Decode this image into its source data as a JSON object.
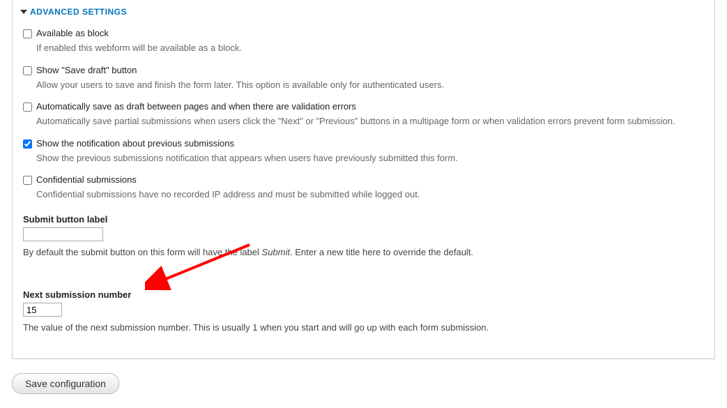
{
  "fieldset": {
    "legend": "ADVANCED SETTINGS"
  },
  "options": {
    "available_as_block": {
      "label": "Available as block",
      "checked": false,
      "description": "If enabled this webform will be available as a block."
    },
    "show_save_draft": {
      "label": "Show \"Save draft\" button",
      "checked": false,
      "description": "Allow your users to save and finish the form later. This option is available only for authenticated users."
    },
    "auto_save_draft": {
      "label": "Automatically save as draft between pages and when there are validation errors",
      "checked": false,
      "description": "Automatically save partial submissions when users click the \"Next\" or \"Previous\" buttons in a multipage form or when validation errors prevent form submission."
    },
    "show_notification": {
      "label": "Show the notification about previous submissions",
      "checked": true,
      "description": "Show the previous submissions notification that appears when users have previously submitted this form."
    },
    "confidential": {
      "label": "Confidential submissions",
      "checked": false,
      "description": "Confidential submissions have no recorded IP address and must be submitted while logged out."
    }
  },
  "submit_label": {
    "label": "Submit button label",
    "value": "",
    "help_prefix": "By default the submit button on this form will have the label ",
    "help_em": "Submit",
    "help_suffix": ". Enter a new title here to override the default."
  },
  "next_submission": {
    "label": "Next submission number",
    "value": "15",
    "help": "The value of the next submission number. This is usually 1 when you start and will go up with each form submission."
  },
  "actions": {
    "save": "Save configuration"
  }
}
